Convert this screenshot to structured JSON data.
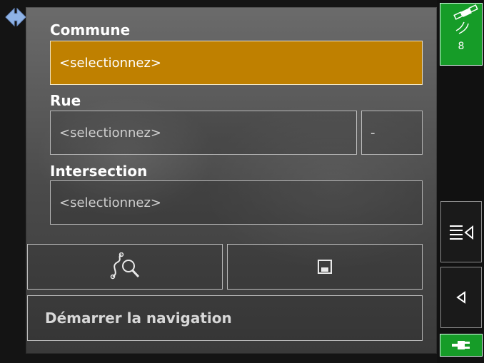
{
  "form": {
    "commune_label": "Commune",
    "commune_value": "<selectionnez>",
    "rue_label": "Rue",
    "rue_value": "<selectionnez>",
    "rue_number": "-",
    "intersection_label": "Intersection",
    "intersection_value": "<selectionnez>"
  },
  "actions": {
    "search_map_icon": "route-search-icon",
    "save_icon": "save-icon",
    "start_navigation_label": "Démarrer la navigation"
  },
  "sidebar": {
    "gps_icon": "satellite-icon",
    "gps_satellites": "8",
    "menu_icon": "list-menu-icon",
    "back_icon": "back-arrow-icon",
    "power_icon": "plug-icon"
  },
  "colors": {
    "accent_orange": "#bf8000",
    "status_green": "#169c28"
  }
}
